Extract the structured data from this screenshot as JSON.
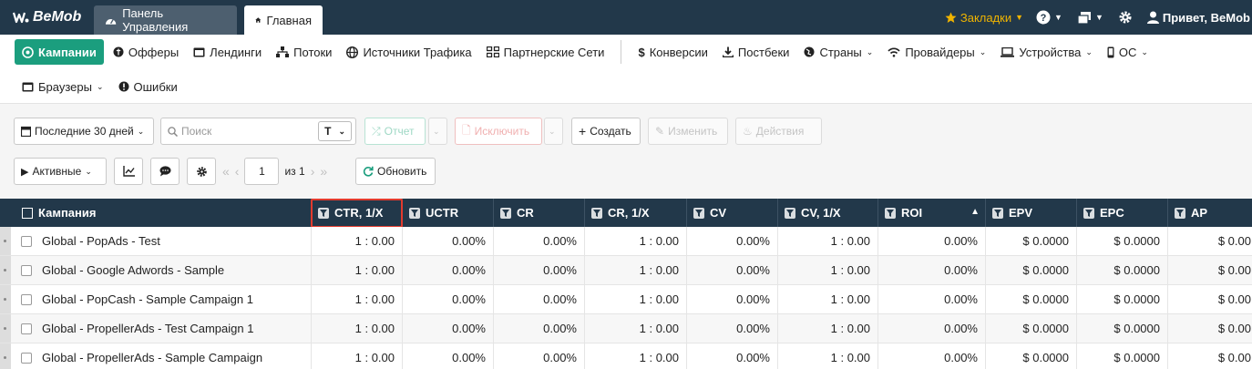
{
  "app": {
    "brand": "BeMob"
  },
  "tabs": [
    {
      "label": "Панель Управления"
    },
    {
      "label": "Главная"
    }
  ],
  "header_right": {
    "bookmarks": "Закладки",
    "greeting": "Привет, BeMob"
  },
  "nav": {
    "row1": [
      {
        "label": "Кампании",
        "icon": "target-icon"
      },
      {
        "label": "Офферы",
        "icon": "gift-icon"
      },
      {
        "label": "Лендинги",
        "icon": "page-icon"
      },
      {
        "label": "Потоки",
        "icon": "flows-icon"
      },
      {
        "label": "Источники Трафика",
        "icon": "globe-icon"
      },
      {
        "label": "Партнерские Сети",
        "icon": "network-icon"
      },
      {
        "label": "Конверсии",
        "icon": "dollar-icon"
      },
      {
        "label": "Постбеки",
        "icon": "download-icon"
      },
      {
        "label": "Страны",
        "icon": "globe-icon"
      },
      {
        "label": "Провайдеры",
        "icon": "wifi-icon"
      },
      {
        "label": "Устройства",
        "icon": "laptop-icon"
      },
      {
        "label": "ОС",
        "icon": "phone-icon"
      }
    ],
    "row2": [
      {
        "label": "Браузеры",
        "icon": "browser-icon"
      },
      {
        "label": "Ошибки",
        "icon": "alert-icon"
      }
    ]
  },
  "toolbar": {
    "date_range": "Последние 30 дней",
    "search_placeholder": "Поиск",
    "search_type": "T",
    "report": "Отчет",
    "exclude": "Исключить",
    "create": "Создать",
    "edit": "Изменить",
    "actions": "Действия",
    "status_filter": "Активные",
    "page": "1",
    "page_of": "из 1",
    "refresh": "Обновить"
  },
  "table": {
    "columns": [
      "Кампания",
      "CTR, 1/X",
      "UCTR",
      "CR",
      "CR, 1/X",
      "CV",
      "CV, 1/X",
      "ROI",
      "EPV",
      "EPC",
      "AP"
    ],
    "rows": [
      [
        "Global - PopAds - Test",
        "1 : 0.00",
        "0.00%",
        "0.00%",
        "1 : 0.00",
        "0.00%",
        "1 : 0.00",
        "0.00%",
        "$ 0.0000",
        "$ 0.0000",
        "$ 0.00"
      ],
      [
        "Global - Google Adwords - Sample",
        "1 : 0.00",
        "0.00%",
        "0.00%",
        "1 : 0.00",
        "0.00%",
        "1 : 0.00",
        "0.00%",
        "$ 0.0000",
        "$ 0.0000",
        "$ 0.00"
      ],
      [
        "Global - PopCash - Sample Campaign 1",
        "1 : 0.00",
        "0.00%",
        "0.00%",
        "1 : 0.00",
        "0.00%",
        "1 : 0.00",
        "0.00%",
        "$ 0.0000",
        "$ 0.0000",
        "$ 0.00"
      ],
      [
        "Global - PropellerAds - Test Campaign 1",
        "1 : 0.00",
        "0.00%",
        "0.00%",
        "1 : 0.00",
        "0.00%",
        "1 : 0.00",
        "0.00%",
        "$ 0.0000",
        "$ 0.0000",
        "$ 0.00"
      ],
      [
        "Global - PropellerAds - Sample Campaign",
        "1 : 0.00",
        "0.00%",
        "0.00%",
        "1 : 0.00",
        "0.00%",
        "1 : 0.00",
        "0.00%",
        "$ 0.0000",
        "$ 0.0000",
        "$ 0.00"
      ]
    ]
  },
  "colors": {
    "header": "#22384a",
    "accent": "#1b9e7e",
    "bookmark": "#f0b400",
    "highlight": "#e23b2e"
  }
}
